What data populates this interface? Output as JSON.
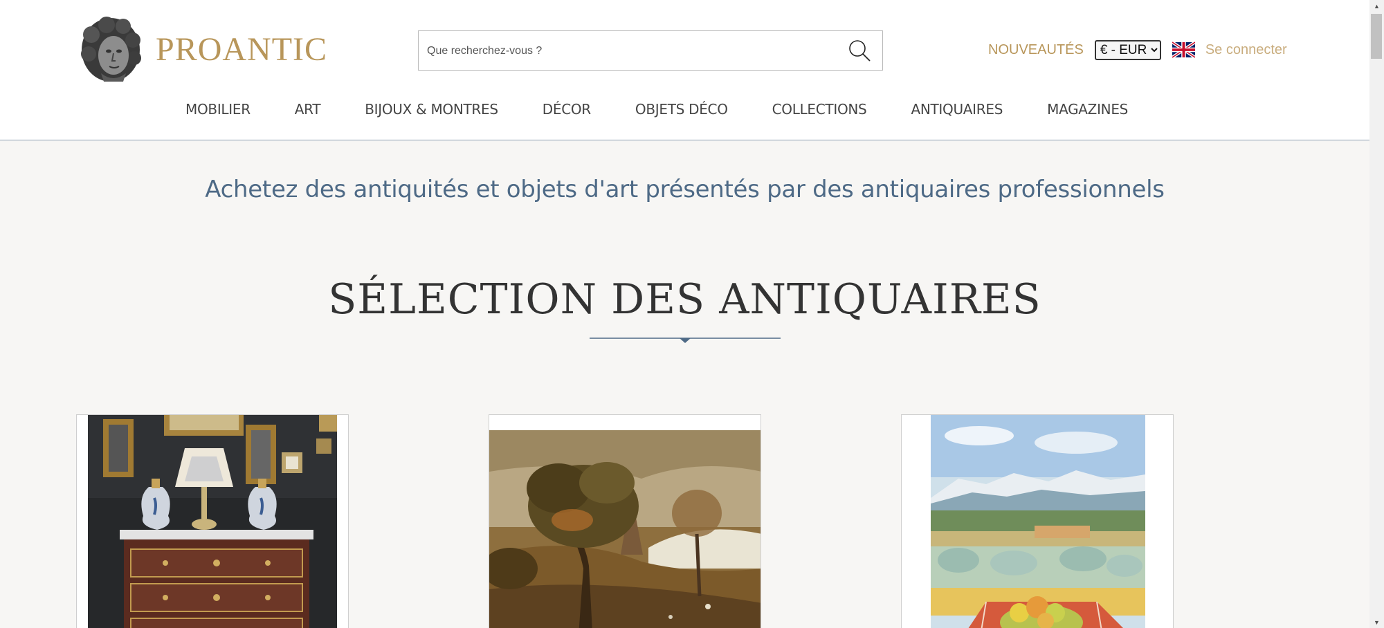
{
  "brand": {
    "name": "PROANTIC"
  },
  "search": {
    "placeholder": "Que recherchez-vous ?"
  },
  "header_links": {
    "nouveautes": "NOUVEAUTÉS",
    "currency_selected": "€ - EUR",
    "language_flag": "uk-flag-icon",
    "login": "Se connecter"
  },
  "nav": [
    {
      "label": "MOBILIER"
    },
    {
      "label": "ART"
    },
    {
      "label": "BIJOUX & MONTRES"
    },
    {
      "label": "DÉCOR"
    },
    {
      "label": "OBJETS DÉCO"
    },
    {
      "label": "COLLECTIONS"
    },
    {
      "label": "ANTIQUAIRES"
    },
    {
      "label": "MAGAZINES"
    }
  ],
  "tagline": "Achetez des antiquités et objets d'art présentés par des antiquaires professionnels",
  "section": {
    "title": "SÉLECTION DES ANTIQUAIRES"
  },
  "colors": {
    "gold": "#b8965a",
    "slate_blue": "#4e6a86",
    "page_bg": "#f7f6f4"
  }
}
